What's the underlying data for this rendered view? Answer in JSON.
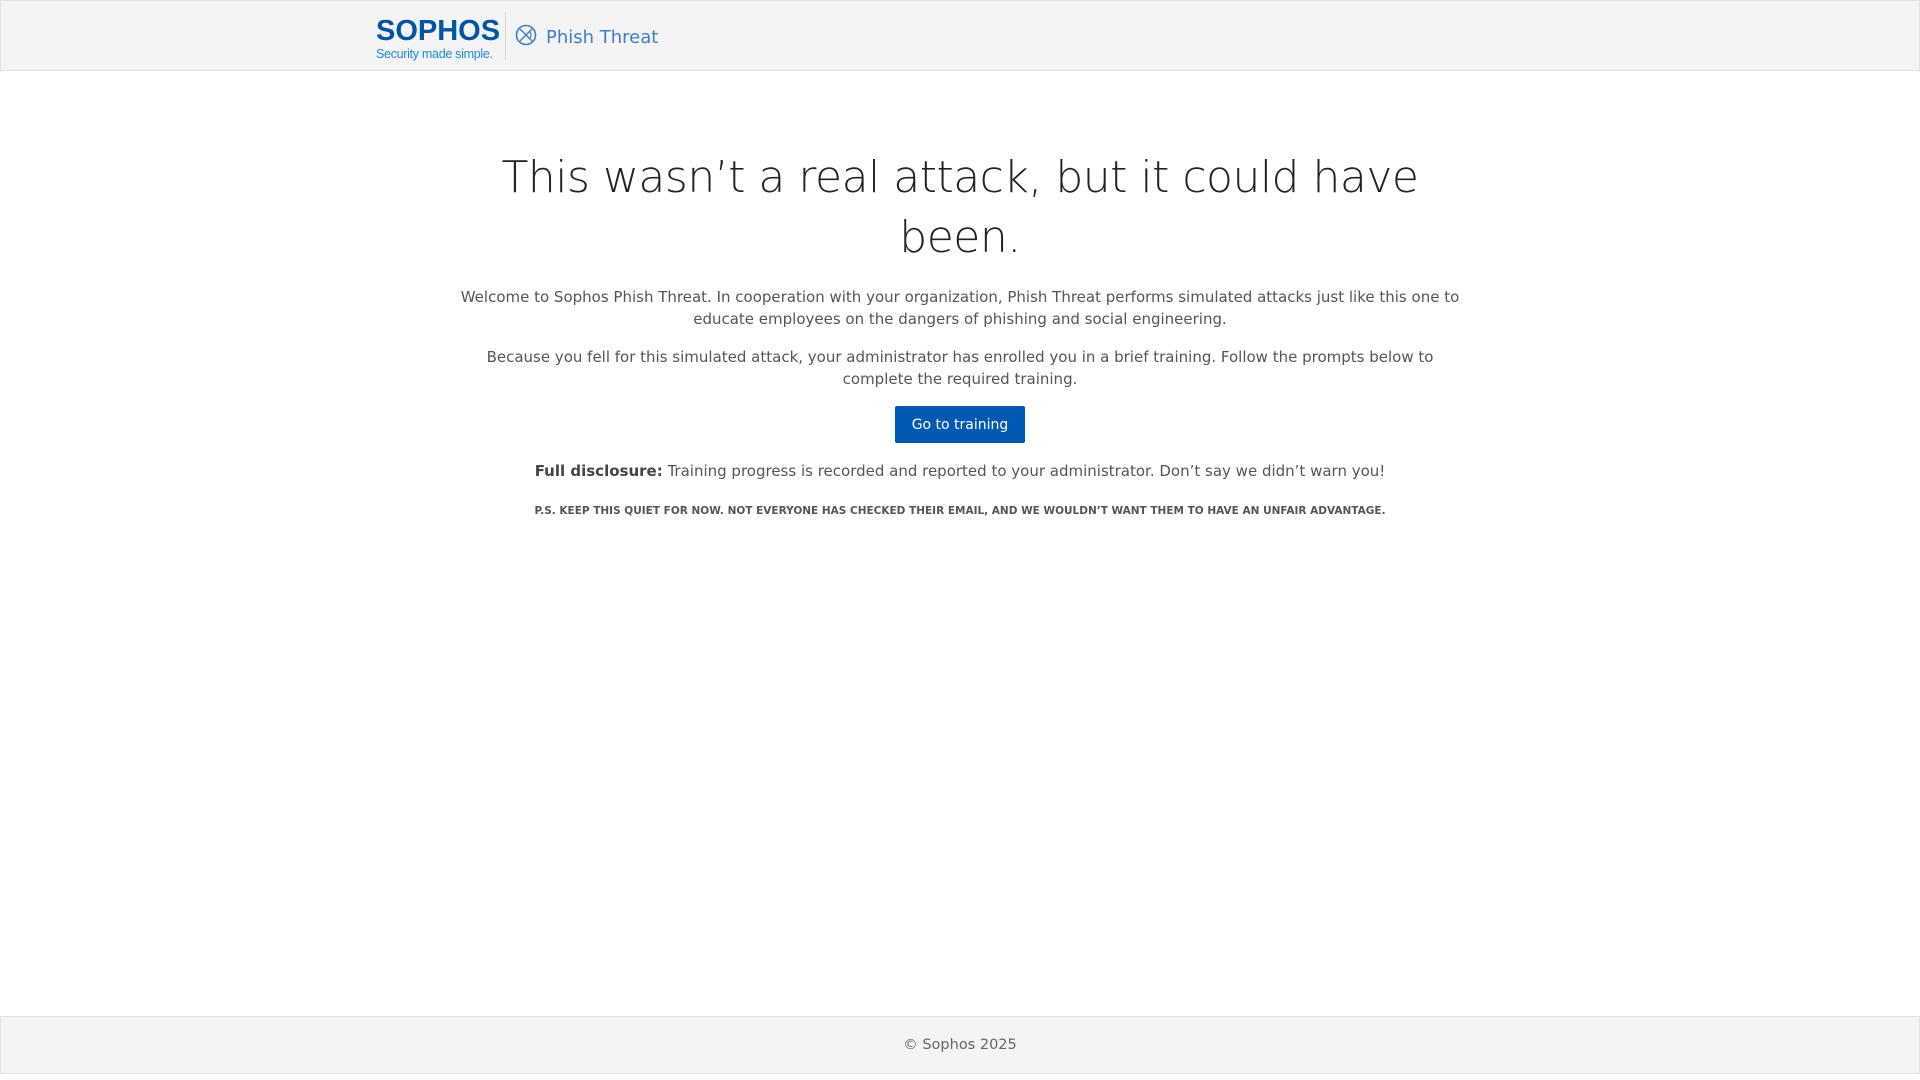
{
  "header": {
    "logo_word": "SOPHOS",
    "logo_tagline": "Security made simple.",
    "product_icon": "phish-threat-icon",
    "product_name": "Phish Threat"
  },
  "main": {
    "title": "This wasn’t a real attack, but it could have been.",
    "intro": "Welcome to Sophos Phish Threat. In cooperation with your organization, Phish Threat performs simulated attacks just like this one to educate employees on the dangers of phishing and social engineering.",
    "enrolled": "Because you fell for this simulated attack, your administrator has enrolled you in a brief training. Follow the prompts below to complete the required training.",
    "button_label": "Go to training",
    "disclosure_label": "Full disclosure:",
    "disclosure_text": " Training progress is recorded and reported to your administrator. Don’t say we didn’t warn you!",
    "ps": "P.S. KEEP THIS QUIET FOR NOW. NOT EVERYONE HAS CHECKED THEIR EMAIL, AND WE WOULDN’T WANT THEM TO HAVE AN UNFAIR ADVANTAGE."
  },
  "footer": {
    "copyright": "© Sophos 2025"
  },
  "colors": {
    "brand": "#0055a5",
    "button": "#005ab4",
    "product": "#3e7ec4"
  }
}
